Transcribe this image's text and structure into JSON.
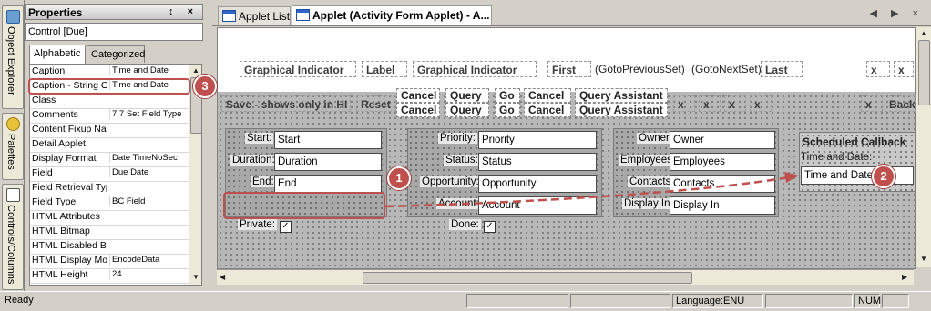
{
  "left_tabs": [
    {
      "label": "Object Explorer",
      "icon": "object-explorer-icon"
    },
    {
      "label": "Palettes",
      "icon": "palettes-icon"
    },
    {
      "label": "Controls/Columns",
      "icon": "controls-icon"
    }
  ],
  "properties": {
    "title": "Properties",
    "title_buttons": "↕ ×",
    "control_label": "Control [Due]",
    "tabs": [
      "Alphabetic",
      "Categorized"
    ],
    "rows": [
      {
        "name": "Caption",
        "value": "Time and Date"
      },
      {
        "name": "Caption - String O",
        "value": "Time and Date"
      },
      {
        "name": "Class",
        "value": ""
      },
      {
        "name": "Comments",
        "value": "7.7 Set Field Type"
      },
      {
        "name": "Content Fixup Nam",
        "value": ""
      },
      {
        "name": "Detail Applet",
        "value": ""
      },
      {
        "name": "Display Format",
        "value": "Date TimeNoSec"
      },
      {
        "name": "Field",
        "value": "Due Date"
      },
      {
        "name": "Field Retrieval Typ",
        "value": ""
      },
      {
        "name": "Field Type",
        "value": "BC Field"
      },
      {
        "name": "HTML Attributes",
        "value": ""
      },
      {
        "name": "HTML Bitmap",
        "value": ""
      },
      {
        "name": "HTML Disabled B",
        "value": ""
      },
      {
        "name": "HTML Display Mo",
        "value": "EncodeData"
      },
      {
        "name": "HTML Height",
        "value": "24"
      }
    ]
  },
  "editor": {
    "tabs": [
      {
        "label": "Applet List",
        "active": false
      },
      {
        "label": "Applet (Activity Form Applet) - A...",
        "active": true
      }
    ],
    "tab_nav": "◀ ▶ ×",
    "row1": [
      {
        "text": "Graphical Indicator",
        "type": "ctrl"
      },
      {
        "text": "Label",
        "type": "ctrl"
      },
      {
        "text": "Graphical Indicator",
        "type": "ctrl"
      },
      {
        "text": "First",
        "type": "ctrl"
      },
      {
        "text": "(GotoPreviousSet)",
        "type": "plain"
      },
      {
        "text": "(GotoNextSet)",
        "type": "plain"
      },
      {
        "text": "Last",
        "type": "ctrl"
      },
      {
        "text": "x",
        "type": "ctrl"
      },
      {
        "text": "x",
        "type": "ctrl"
      }
    ],
    "row2_left": [
      {
        "text": "Save - shows only in HI"
      },
      {
        "text": "Reset"
      }
    ],
    "buttons_top": [
      "Cancel",
      "Query",
      "Go",
      "Cancel",
      "Query Assistant"
    ],
    "buttons_bottom": [
      "Cancel",
      "Query",
      "Go",
      "Cancel",
      "Query Assistant"
    ],
    "row2_right": [
      "x",
      "x",
      "x",
      "x",
      "x",
      "Back"
    ],
    "form1": {
      "labels": [
        "Start:",
        "Duration:",
        "End:",
        "Private:"
      ],
      "fields": [
        "Start",
        "Duration",
        "End"
      ],
      "private_checked": "✓"
    },
    "form2": {
      "labels": [
        "Priority:",
        "Status:",
        "Opportunity:",
        "Account:",
        "Done:"
      ],
      "fields": [
        "Priority",
        "Status",
        "Opportunity",
        "Account"
      ],
      "done_checked": "✓"
    },
    "form3": {
      "labels": [
        "Owner:",
        "Employees:",
        "Contacts:",
        "Display In:"
      ],
      "fields": [
        "Owner",
        "Employees",
        "Contacts",
        "Display In"
      ]
    },
    "callback": {
      "title": "Scheduled Callback",
      "label": "Time and Date:",
      "field": "Time and Date"
    }
  },
  "callouts": [
    "1",
    "2",
    "3"
  ],
  "status_bar": {
    "ready": "Ready",
    "language": "Language:ENU",
    "num": "NUM"
  },
  "colors": {
    "callout": "#c0504d",
    "window_bg": "#d4d0c8"
  }
}
